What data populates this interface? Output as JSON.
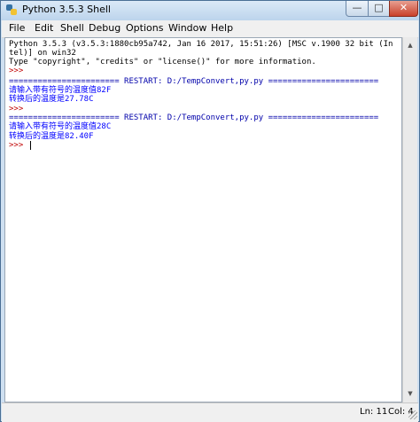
{
  "window": {
    "title": "Python 3.5.3 Shell",
    "controls": {
      "minimize": "—",
      "maximize": "□",
      "close": "✕"
    }
  },
  "menu": [
    "File",
    "Edit",
    "Shell",
    "Debug",
    "Options",
    "Window",
    "Help"
  ],
  "shell": {
    "lines": [
      {
        "text": "Python 3.5.3 (v3.5.3:1880cb95a742, Jan 16 2017, 15:51:26) [MSC v.1900 32 bit (In",
        "style": "out"
      },
      {
        "text": "tel)] on win32",
        "style": "out"
      },
      {
        "text": "Type \"copyright\", \"credits\" or \"license()\" for more information.",
        "style": "out"
      },
      {
        "text": ">>>",
        "style": "prompt"
      },
      {
        "text": "======================= RESTART: D:/TempConvert,py.py =======================",
        "style": "restart"
      },
      {
        "text": "请输入带有符号的温度值82F",
        "style": "user"
      },
      {
        "text": "转换后的温度是27.78C",
        "style": "user"
      },
      {
        "text": ">>>",
        "style": "prompt"
      },
      {
        "text": "======================= RESTART: D:/TempConvert,py.py =======================",
        "style": "restart"
      },
      {
        "text": "请输入带有符号的温度值28C",
        "style": "user"
      },
      {
        "text": "转换后的温度是82.40F",
        "style": "user"
      },
      {
        "text": ">>>",
        "style": "prompt"
      }
    ]
  },
  "status": {
    "line": "Ln: 11",
    "col": "Col: 4"
  },
  "colors": {
    "prompt": "#c00000",
    "output": "#0000ff",
    "restart": "#0000aa"
  }
}
